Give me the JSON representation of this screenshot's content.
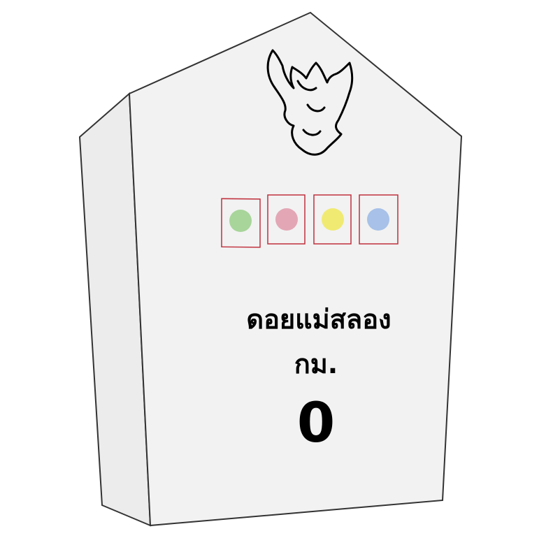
{
  "marker": {
    "place_name": "ดอยแม่สลอง",
    "unit": "กม.",
    "distance": "0",
    "dot_colors": [
      "#a8d59a",
      "#e3a6b5",
      "#f0ea72",
      "#a7c1e8"
    ]
  },
  "colors": {
    "outline": "#333333",
    "front_face": "#f2f2f2",
    "side_face": "#ececec",
    "box_border": "#c0303c",
    "text": "#000000"
  }
}
